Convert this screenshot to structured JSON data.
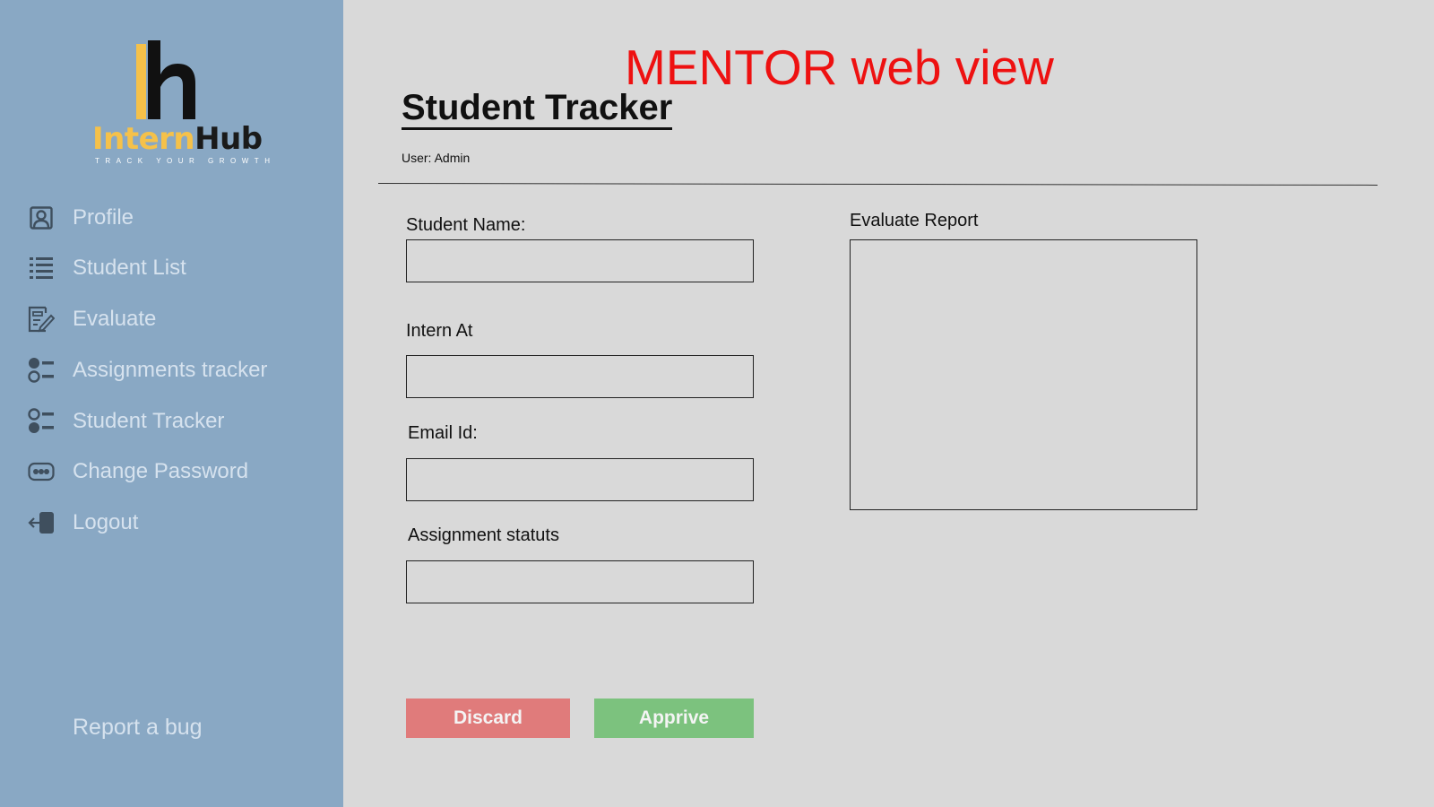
{
  "brand": {
    "intern": "Intern",
    "hub": "Hub",
    "tagline": "TRACK YOUR GROWTH"
  },
  "sidebar": {
    "items": [
      {
        "label": "Profile",
        "icon": "profile-icon"
      },
      {
        "label": "Student List",
        "icon": "list-icon"
      },
      {
        "label": "Evaluate",
        "icon": "evaluate-icon"
      },
      {
        "label": "Assignments tracker",
        "icon": "tracker-icon"
      },
      {
        "label": "Student Tracker",
        "icon": "tracker-icon"
      },
      {
        "label": "Change Password",
        "icon": "password-icon"
      },
      {
        "label": "Logout",
        "icon": "logout-icon"
      }
    ],
    "report_bug": "Report a bug"
  },
  "header": {
    "banner": "MENTOR web view",
    "title": "Student Tracker",
    "user_line": "User: Admin"
  },
  "form": {
    "student_name_label": "Student Name:",
    "student_name_value": "",
    "intern_at_label": "Intern At",
    "intern_at_value": "",
    "email_label": "Email Id:",
    "email_value": "",
    "assignment_status_label": "Assignment statuts",
    "assignment_status_value": "",
    "evaluate_report_label": "Evaluate Report",
    "evaluate_report_value": ""
  },
  "actions": {
    "discard": "Discard",
    "approve": "Apprive"
  },
  "colors": {
    "sidebar_bg": "#89a8c4",
    "main_bg": "#d9d9d9",
    "banner": "#ee1111",
    "discard": "#e07b7b",
    "approve": "#7cc27e",
    "logo_yellow": "#f5c14a"
  }
}
